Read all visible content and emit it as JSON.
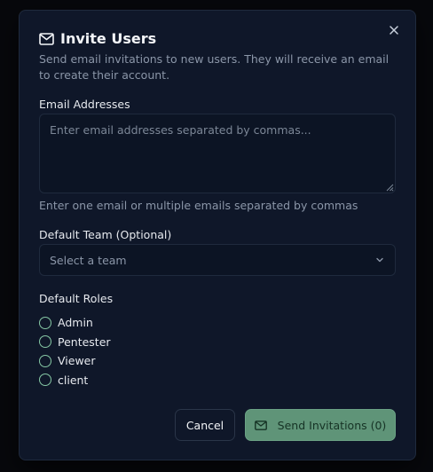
{
  "dialog": {
    "title": "Invite Users",
    "description": "Send email invitations to new users. They will receive an email to create their account.",
    "close_icon": "close-icon",
    "title_icon": "mail-icon"
  },
  "email_field": {
    "label": "Email Addresses",
    "placeholder": "Enter email addresses separated by commas...",
    "value": "",
    "hint": "Enter one email or multiple emails separated by commas"
  },
  "team_field": {
    "label": "Default Team (Optional)",
    "placeholder": "Select a team",
    "icon": "chevron-down-icon"
  },
  "roles": {
    "label": "Default Roles",
    "items": [
      {
        "label": "Admin",
        "selected": false
      },
      {
        "label": "Pentester",
        "selected": false
      },
      {
        "label": "Viewer",
        "selected": false
      },
      {
        "label": "client",
        "selected": false
      }
    ]
  },
  "actions": {
    "cancel_label": "Cancel",
    "send_label": "Send Invitations (0)",
    "send_icon": "mail-icon"
  },
  "colors": {
    "accent": "#5f9478",
    "radio_border": "#86c8a5",
    "modal_bg": "#0f1729"
  }
}
